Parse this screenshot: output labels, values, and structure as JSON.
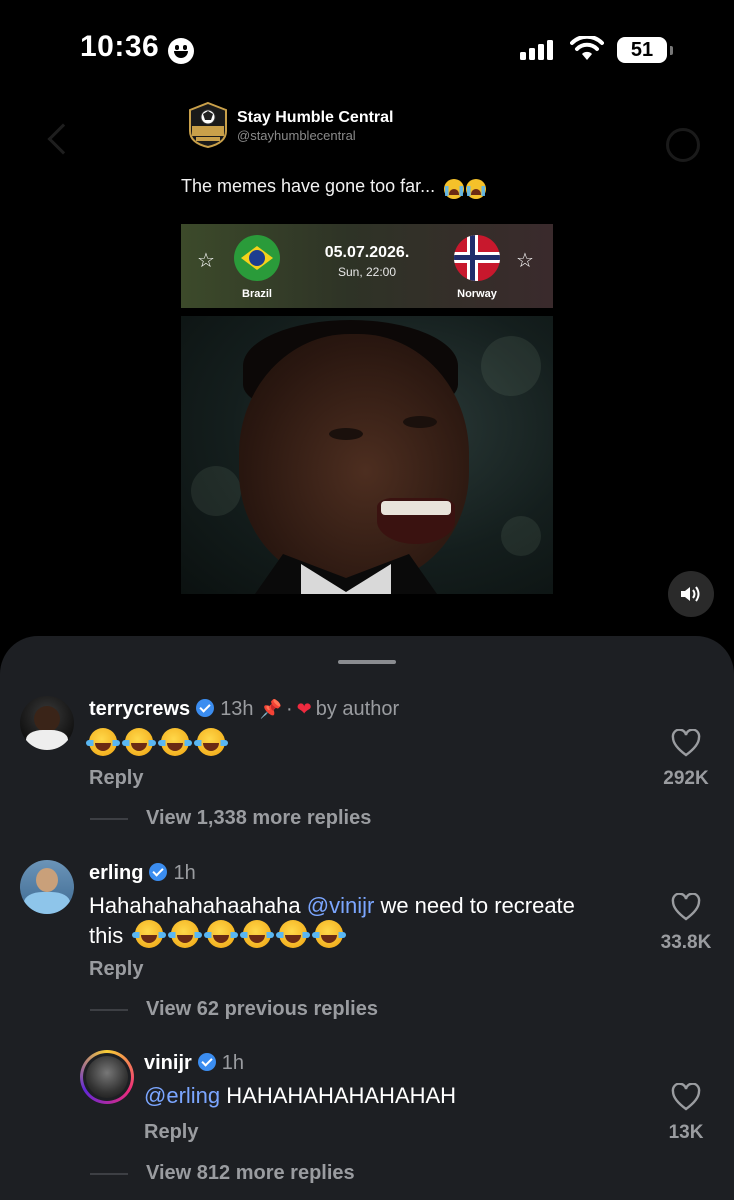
{
  "status_bar": {
    "time": "10:36",
    "battery": "51"
  },
  "post": {
    "account_name": "Stay Humble Central",
    "account_handle": "@stayhumblecentral",
    "logo_text": "STAY HUMBLE CENTRAL",
    "caption": "The memes have gone too far...",
    "caption_emoji": "loudly-crying-face x2",
    "match": {
      "date": "05.07.2026.",
      "time": "Sun, 22:00",
      "home_team": "Brazil",
      "away_team": "Norway"
    }
  },
  "comments": [
    {
      "user": "terrycrews",
      "verified": true,
      "time": "13h",
      "pinned": true,
      "liked_by_author_label": "by author",
      "emoji": "face-with-tears-of-joy x4",
      "reply_label": "Reply",
      "likes": "292K",
      "view_more": "View 1,338 more replies"
    },
    {
      "user": "erling",
      "verified": true,
      "time": "1h",
      "text_before": "Hahahahahahaahaha ",
      "mention": "@vinijr",
      "text_after": " we need to recreate",
      "text_line2": "this",
      "emoji": "face-with-tears-of-joy x6",
      "reply_label": "Reply",
      "likes": "33.8K",
      "view_more": "View 62 previous replies"
    },
    {
      "user": "vinijr",
      "verified": true,
      "time": "1h",
      "mention": "@erling",
      "text_after": " HAHAHAHAHAHAHAH",
      "reply_label": "Reply",
      "likes": "13K",
      "view_more": "View 812 more replies"
    }
  ]
}
